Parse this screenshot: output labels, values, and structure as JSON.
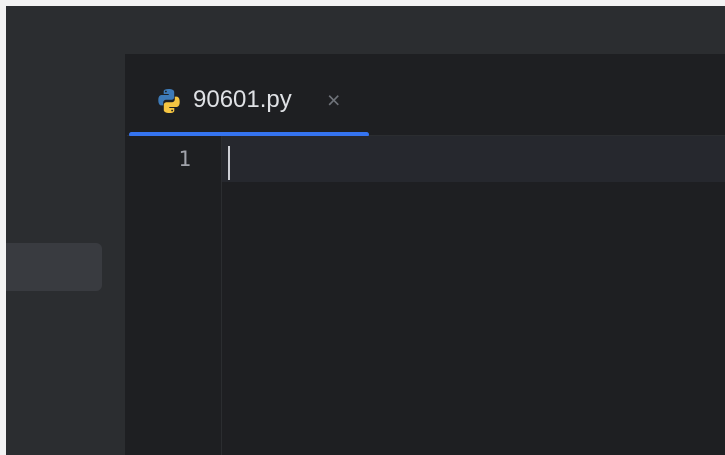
{
  "editor": {
    "tab": {
      "filename": "90601.py",
      "icon": "python-file-icon",
      "close_symbol": "×",
      "active": true
    },
    "gutter": {
      "line_numbers": [
        "1"
      ]
    },
    "content": "",
    "colors": {
      "background": "#1e1f22",
      "panel": "#2b2d30",
      "accent": "#3574f0",
      "text": "#dfe1e5"
    }
  }
}
